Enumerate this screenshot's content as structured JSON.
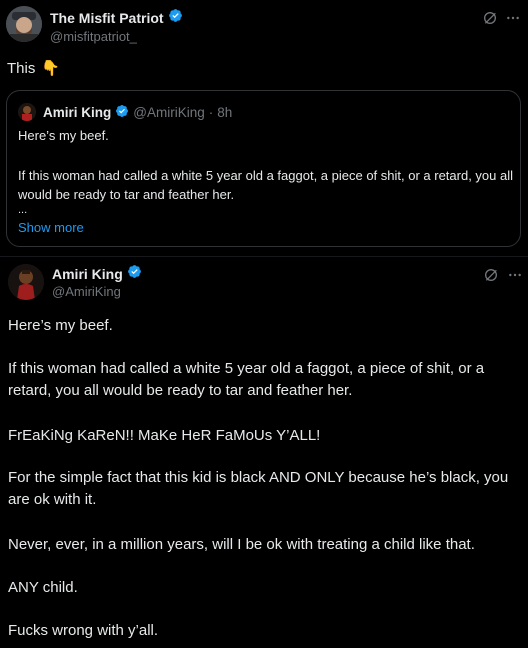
{
  "tweet": {
    "author_name": "The Misfit Patriot",
    "handle": "@misfitpatriot_",
    "text": "This",
    "emoji": "👇"
  },
  "quote": {
    "author_name": "Amiri King",
    "handle": "@AmiriKing",
    "separator": "·",
    "time": "8h",
    "line1": "Here’s my beef.",
    "line2": "If this woman had called a white 5 year old a faggot, a piece of shit, or a retard, you all would be ready to tar and feather her.",
    "ellipsis": "...",
    "show_more": "Show more"
  },
  "second_post": {
    "author_name": "Amiri King",
    "handle": "@AmiriKing",
    "paragraphs": [
      "Here’s my beef.",
      "If this woman had called a white 5 year old a faggot, a piece of shit, or a retard, you all would be ready to tar and feather her.",
      "FrEaKiNg KaReN!! MaKe HeR FaMoUs Y’ALL!",
      "For the simple fact that this kid is black AND ONLY because he’s black, you are ok with it.",
      "Never, ever, in a million years, will I be ok with treating a child like that.",
      "ANY child.",
      "Fucks wrong with y’all."
    ]
  },
  "icons": {
    "grok": "grok-icon",
    "more": "more-icon",
    "verified": "verified-badge-icon"
  },
  "colors": {
    "background": "#000000",
    "text": "#e7e9ea",
    "muted": "#71767b",
    "link": "#1d9bf0",
    "verified": "#1d9bf0"
  }
}
